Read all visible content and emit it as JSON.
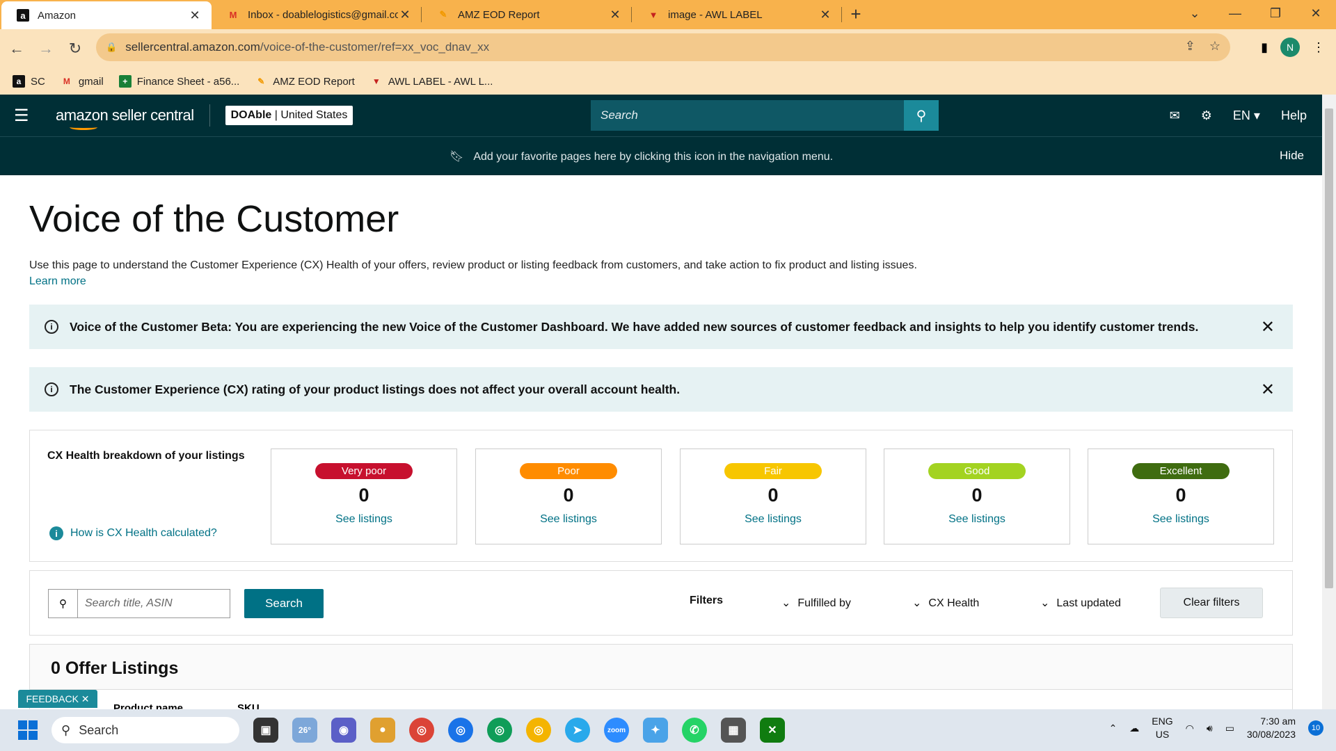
{
  "browser": {
    "tabs": [
      {
        "title": "Amazon",
        "favicon": "a",
        "color": "#111"
      },
      {
        "title": "Inbox - doablelogistics@gmail.co",
        "favicon": "M",
        "color": "#d93025"
      },
      {
        "title": "AMZ EOD Report",
        "favicon": "✎",
        "color": "#f29900"
      },
      {
        "title": "image - AWL LABEL",
        "favicon": "▼",
        "color": "#c5221f"
      }
    ],
    "url_domain": "sellercentral.amazon.com",
    "url_path": "/voice-of-the-customer/ref=xx_voc_dnav_xx",
    "profile_initial": "N",
    "bookmarks": [
      {
        "label": "SC",
        "icon": "a",
        "color": "#111"
      },
      {
        "label": "gmail",
        "icon": "M",
        "color": "#d93025"
      },
      {
        "label": "Finance Sheet - a56...",
        "icon": "+",
        "color": "#188038"
      },
      {
        "label": "AMZ EOD Report",
        "icon": "✎",
        "color": "#f29900"
      },
      {
        "label": "AWL LABEL - AWL L...",
        "icon": "▼",
        "color": "#c5221f"
      }
    ]
  },
  "header": {
    "logo_text": "amazon seller central",
    "store_name": "DOAble",
    "store_region": "United States",
    "search_placeholder": "Search",
    "language": "EN",
    "help": "Help"
  },
  "favbar": {
    "message": "Add your favorite pages here by clicking this icon in the navigation menu.",
    "hide": "Hide"
  },
  "page": {
    "title": "Voice of the Customer",
    "intro": "Use this page to understand the Customer Experience (CX) Health of your offers, review product or listing feedback from customers, and take action to fix product and listing issues.",
    "learn_more": "Learn more",
    "banner1": "Voice of the Customer Beta: You are experiencing the new Voice of the Customer Dashboard. We have added new sources of customer feedback and insights to help you identify customer trends.",
    "banner2": "The Customer Experience (CX) rating of your product listings does not affect your overall account health."
  },
  "cx": {
    "title": "CX Health breakdown of your listings",
    "how_link": "How is CX Health calculated?",
    "cards": [
      {
        "label": "Very poor",
        "count": "0",
        "link": "See listings",
        "color": "#c7102e"
      },
      {
        "label": "Poor",
        "count": "0",
        "link": "See listings",
        "color": "#ff8c00"
      },
      {
        "label": "Fair",
        "count": "0",
        "link": "See listings",
        "color": "#f7c600"
      },
      {
        "label": "Good",
        "count": "0",
        "link": "See listings",
        "color": "#a3d321"
      },
      {
        "label": "Excellent",
        "count": "0",
        "link": "See listings",
        "color": "#3f6c10"
      }
    ]
  },
  "filters": {
    "search_placeholder": "Search title, ASIN",
    "search_button": "Search",
    "label": "Filters",
    "fulfilled_by": "Fulfilled by",
    "cx_health": "CX Health",
    "last_updated": "Last updated",
    "clear": "Clear filters"
  },
  "offers": {
    "heading": "0 Offer Listings",
    "col_product": "Product name",
    "col_sku": "SKU"
  },
  "feedback": "FEEDBACK ✕",
  "taskbar": {
    "search": "Search",
    "weather": "26°",
    "lang1": "ENG",
    "lang2": "US",
    "time": "7:30 am",
    "date": "30/08/2023",
    "notif": "10"
  }
}
